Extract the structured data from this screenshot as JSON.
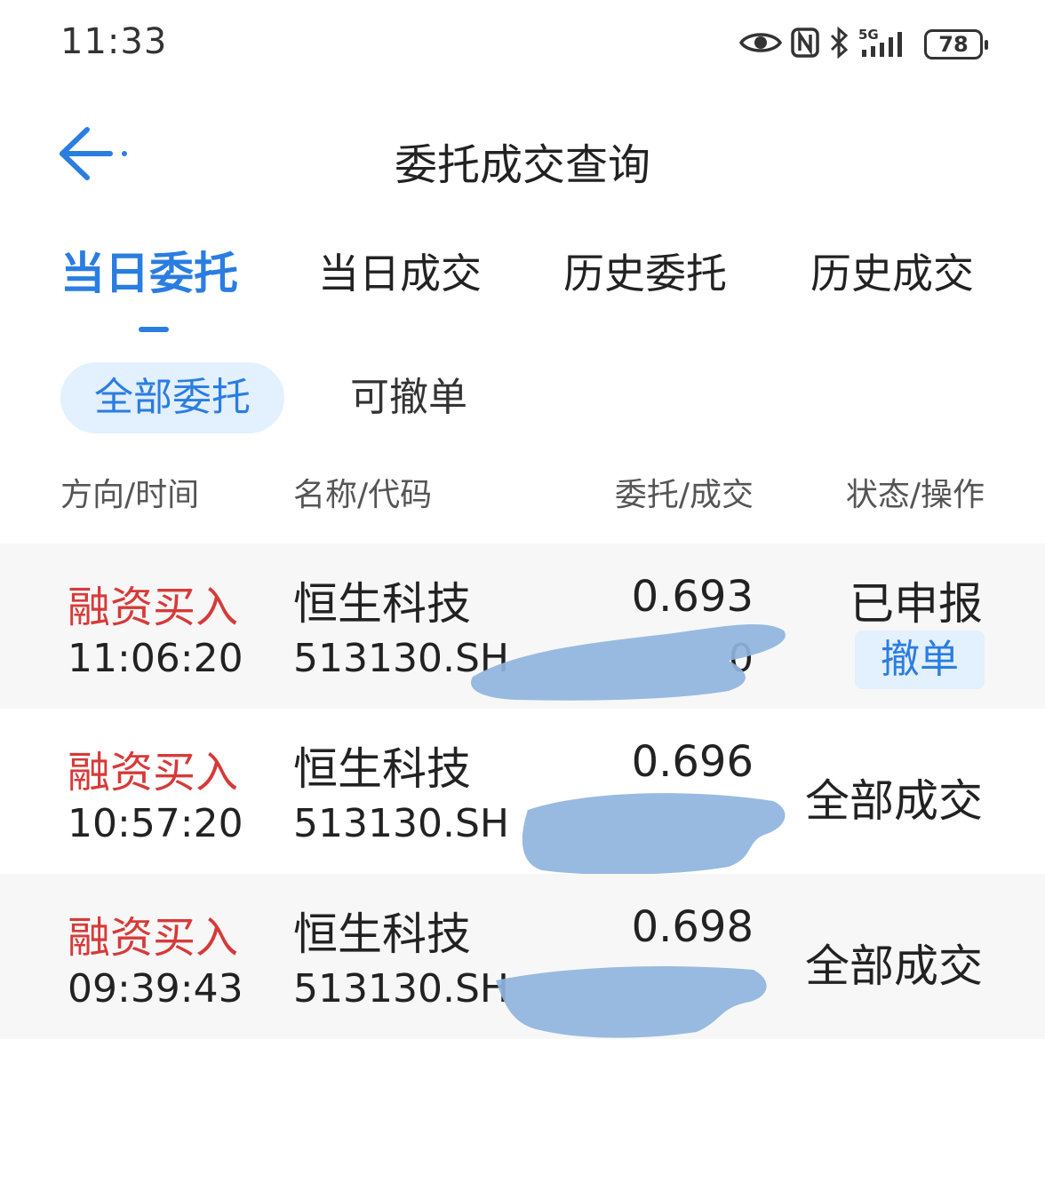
{
  "status_bar": {
    "time": "11:33",
    "network": "5G",
    "battery": "78",
    "icons": [
      "eye-icon",
      "nfc-icon",
      "bluetooth-icon",
      "signal-icon",
      "battery-icon"
    ]
  },
  "header": {
    "back_icon": "arrow-left-icon",
    "title": "委托成交查询"
  },
  "tabs": [
    {
      "label": "当日委托",
      "active": true
    },
    {
      "label": "当日成交",
      "active": false
    },
    {
      "label": "历史委托",
      "active": false
    },
    {
      "label": "历史成交",
      "active": false
    }
  ],
  "filters": [
    {
      "label": "全部委托",
      "active": true
    },
    {
      "label": "可撤单",
      "active": false
    }
  ],
  "columns": [
    "方向/时间",
    "名称/代码",
    "委托/成交",
    "状态/操作"
  ],
  "orders": [
    {
      "direction": "融资买入",
      "time": "11:06:20",
      "name": "恒生科技",
      "code": "513130.SH",
      "price": "0.693",
      "filled": "0",
      "status": "已申报",
      "action": "撤单"
    },
    {
      "direction": "融资买入",
      "time": "10:57:20",
      "name": "恒生科技",
      "code": "513130.SH",
      "price": "0.696",
      "filled": "",
      "status": "全部成交",
      "action": ""
    },
    {
      "direction": "融资买入",
      "time": "09:39:43",
      "name": "恒生科技",
      "code": "513130.SH",
      "price": "0.698",
      "filled": "",
      "status": "全部成交",
      "action": ""
    }
  ],
  "colors": {
    "accent": "#2a7de1",
    "buy": "#d63a38",
    "chip_bg": "#e3f0fd",
    "row_alt_bg": "#f7f7f7",
    "redaction": "#8fb4dd"
  }
}
